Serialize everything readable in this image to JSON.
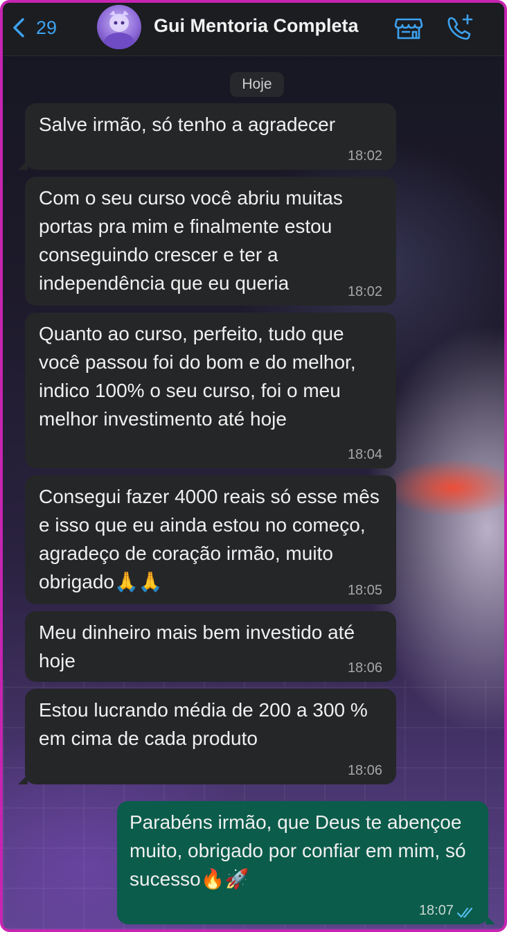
{
  "header": {
    "back_count": "29",
    "title": "Gui Mentoria Completa",
    "icons": [
      "back-chevron-icon",
      "store-icon",
      "call-add-icon"
    ],
    "accent_color": "#3da2f0"
  },
  "date_label": "Hoje",
  "messages": [
    {
      "direction": "in",
      "text": "Salve irmão, só tenho a agradecer",
      "time": "18:02"
    },
    {
      "direction": "in",
      "text": "Com o seu curso você abriu muitas portas pra mim e finalmente estou conseguindo crescer e ter a independência que eu queria",
      "time": "18:02"
    },
    {
      "direction": "in",
      "text": "Quanto ao curso, perfeito, tudo que você passou foi do bom e do melhor, indico 100% o seu curso, foi o meu melhor investimento até hoje",
      "time": "18:04"
    },
    {
      "direction": "in",
      "text": "Consegui fazer 4000 reais só esse mês e isso que eu ainda estou no começo, agradeço de coração irmão, muito obrigado🙏🙏",
      "time": "18:05"
    },
    {
      "direction": "in",
      "text": "Meu dinheiro mais bem investido até hoje",
      "time": "18:06"
    },
    {
      "direction": "in",
      "text": "Estou lucrando média de 200 a 300 % em cima de cada produto",
      "time": "18:06"
    },
    {
      "direction": "out",
      "text": "Parabéns irmão, que Deus te abençoe muito, obrigado por confiar em mim, só sucesso🔥🚀",
      "time": "18:07",
      "status": "read"
    }
  ],
  "colors": {
    "incoming_bubble": "#252628",
    "outgoing_bubble": "#0b5c4b",
    "frame_border": "#c724b1",
    "read_ticks": "#53bdeb"
  }
}
